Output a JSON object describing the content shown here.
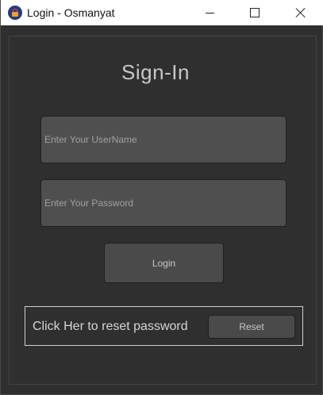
{
  "window": {
    "title": "Login - Osmanyat",
    "app_icon": "lock-icon",
    "controls": {
      "minimize_icon": "minimize-icon",
      "maximize_icon": "maximize-icon",
      "close_icon": "close-icon"
    }
  },
  "form": {
    "heading": "Sign-In",
    "username": {
      "placeholder": "Enter Your UserName",
      "value": ""
    },
    "password": {
      "placeholder": "Enter Your Password",
      "value": ""
    },
    "login_label": "Login"
  },
  "reset": {
    "label": "Click Her to reset password",
    "button_label": "Reset"
  },
  "colors": {
    "background": "#2f2f2f",
    "field": "#4f4f4f",
    "button": "#4a4a4a",
    "text": "#c8c8c8",
    "titlebar": "#ffffff"
  }
}
